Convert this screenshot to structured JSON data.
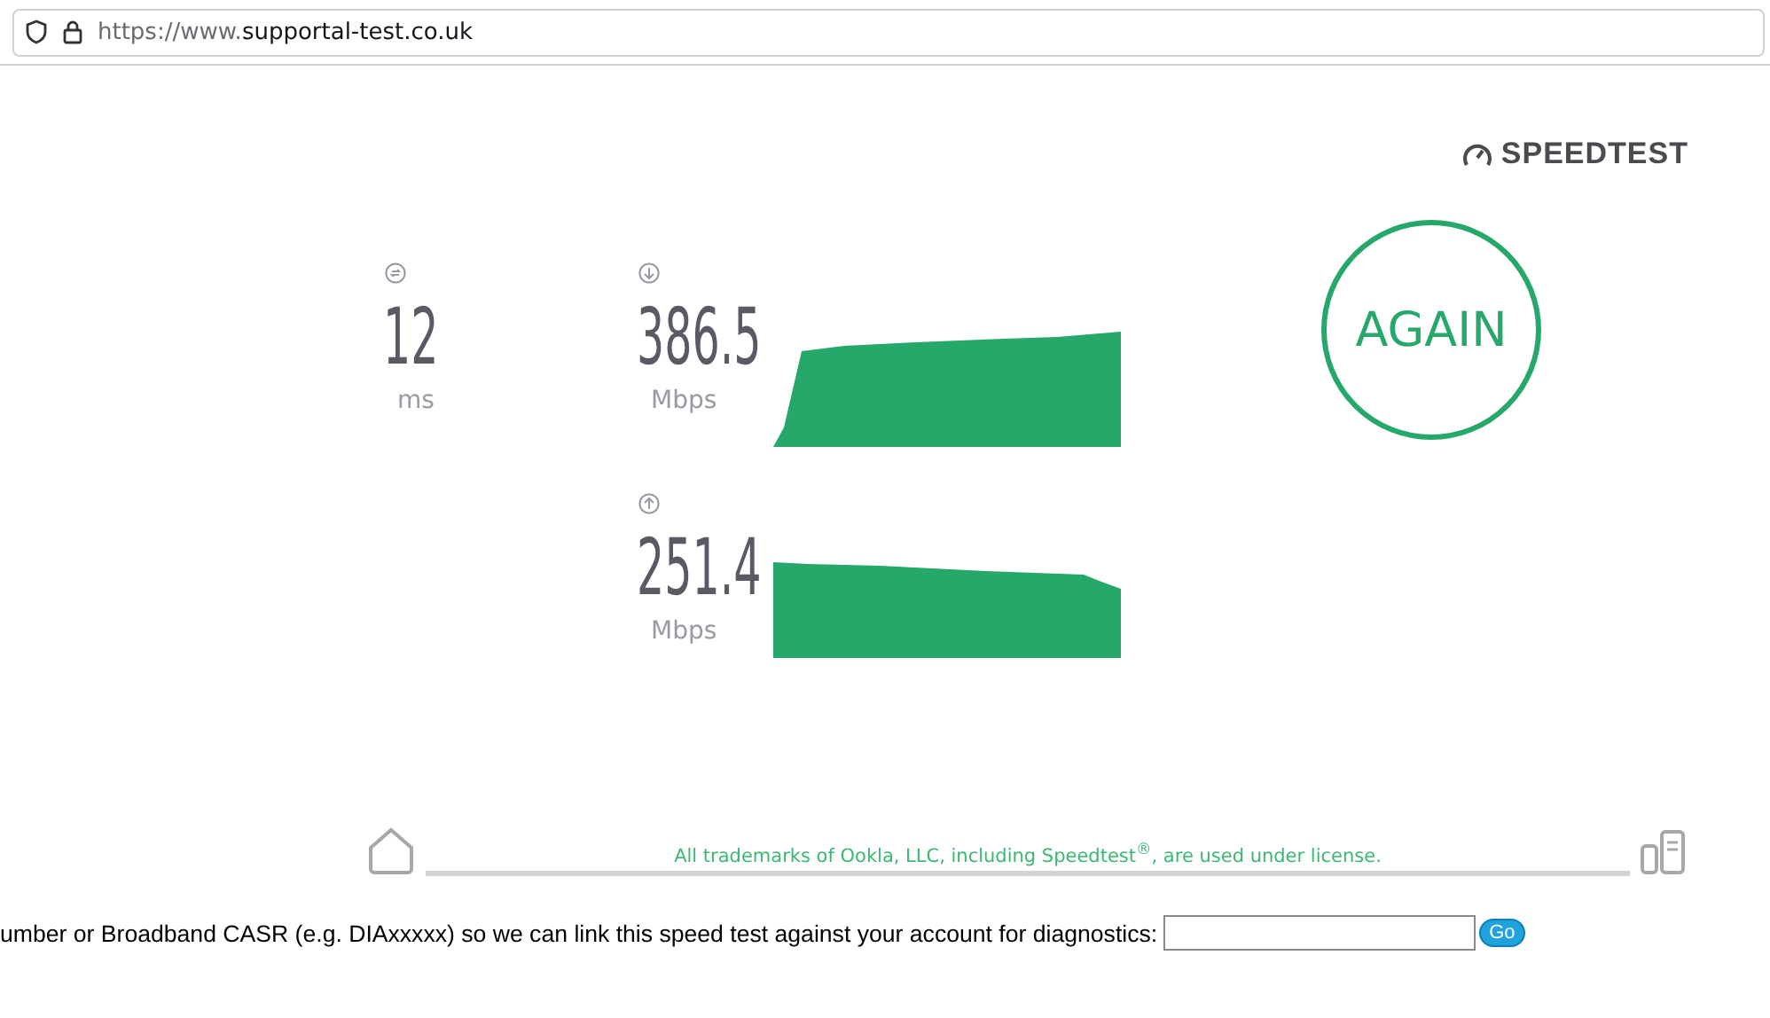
{
  "address_bar": {
    "url_prefix": "https://www.",
    "url_domain": "supportal-test.co.uk"
  },
  "logo": {
    "text": "SPEEDTEST"
  },
  "results": [
    {
      "kind": "ping",
      "value": "12",
      "unit": "ms"
    },
    {
      "kind": "download",
      "value": "386.5",
      "unit": "Mbps"
    },
    {
      "kind": "upload",
      "value": "251.4",
      "unit": "Mbps"
    }
  ],
  "again_button": {
    "label": "AGAIN"
  },
  "footer": {
    "notice": "All trademarks of Ookla, LLC, including Speedtest$^{®}$, are used under license."
  },
  "account_form": {
    "prompt": "umber or Broadband CASR (e.g. DIAxxxxx) so we can link this speed test against your account for diagnostics:",
    "button": "Go"
  }
}
